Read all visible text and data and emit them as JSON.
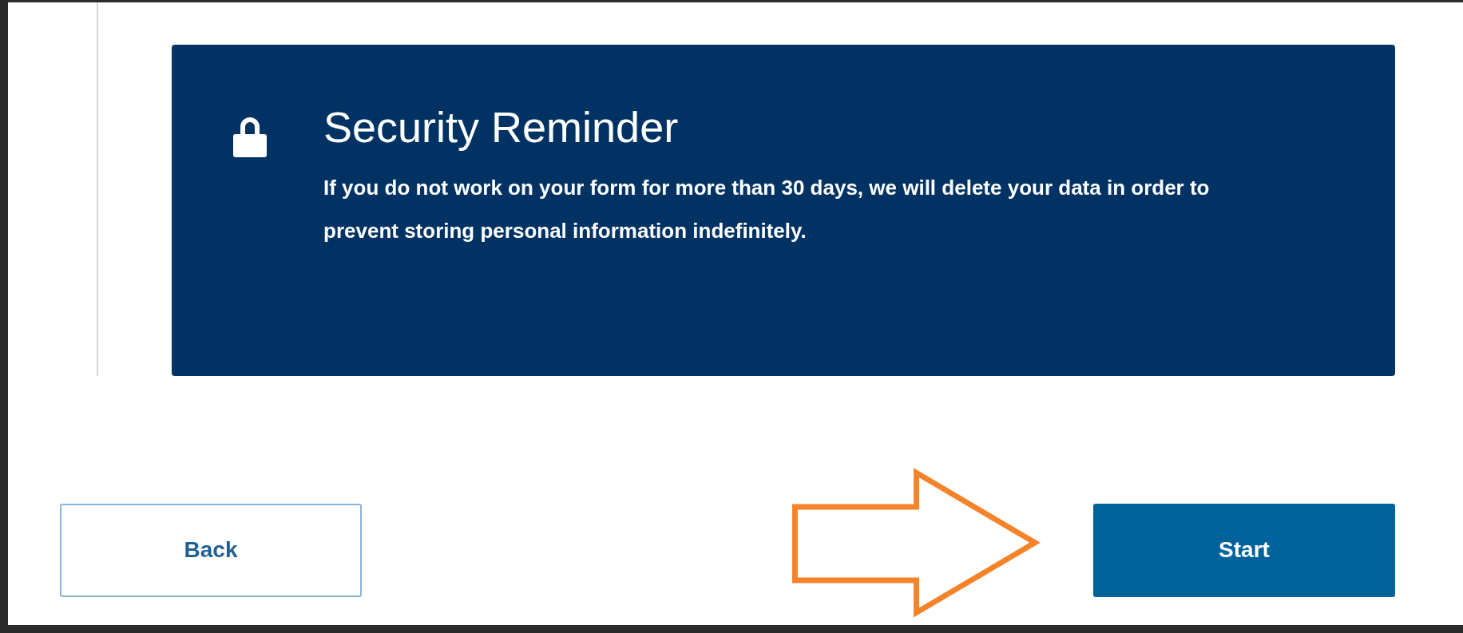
{
  "reminder": {
    "title": "Security Reminder",
    "message": "If you do not work on your form for more than 30 days, we will delete your data in order to prevent storing personal information indefinitely."
  },
  "buttons": [
    {
      "label": "Back",
      "kind": "secondary"
    },
    {
      "label": "Start",
      "kind": "primary"
    }
  ]
}
